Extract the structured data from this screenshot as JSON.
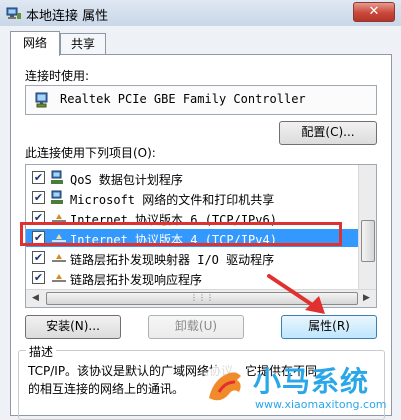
{
  "window": {
    "title": "本地连接 属性",
    "close_glyph": "✕"
  },
  "tabs": [
    {
      "label": "网络"
    },
    {
      "label": "共享"
    }
  ],
  "connect_using": {
    "label": "连接时使用:",
    "adapter": "Realtek PCIe GBE Family Controller",
    "configure_button": "配置(C)..."
  },
  "items_section": {
    "label": "此连接使用下列项目(O):",
    "items": [
      {
        "text": "QoS 数据包计划程序",
        "checked": true,
        "icon": "network-client-icon"
      },
      {
        "text": "Microsoft 网络的文件和打印机共享",
        "checked": true,
        "icon": "network-client-icon"
      },
      {
        "text": "Internet 协议版本 6 (TCP/IPv6)",
        "checked": true,
        "icon": "protocol-icon"
      },
      {
        "text": "Internet 协议版本 4 (TCP/IPv4)",
        "checked": true,
        "icon": "protocol-icon"
      },
      {
        "text": "链路层拓扑发现映射器 I/O 驱动程序",
        "checked": true,
        "icon": "protocol-icon"
      },
      {
        "text": "链路层拓扑发现响应程序",
        "checked": true,
        "icon": "protocol-icon"
      }
    ],
    "check_glyph": "✔"
  },
  "buttons": {
    "install": "安装(N)...",
    "uninstall": "卸载(U)",
    "properties": "属性(R)"
  },
  "description": {
    "title": "描述",
    "line1": "TCP/IP。该协议是默认的广域网络协议，它提供在不同",
    "line2": "的相互连接的网络上的通讯。"
  },
  "watermark": {
    "brand": "小马系统",
    "url": "www.xiaomaxitong.com"
  },
  "colors": {
    "selection": "#3399ff",
    "highlight": "#e03030",
    "watermark": "#2aa7e8"
  }
}
